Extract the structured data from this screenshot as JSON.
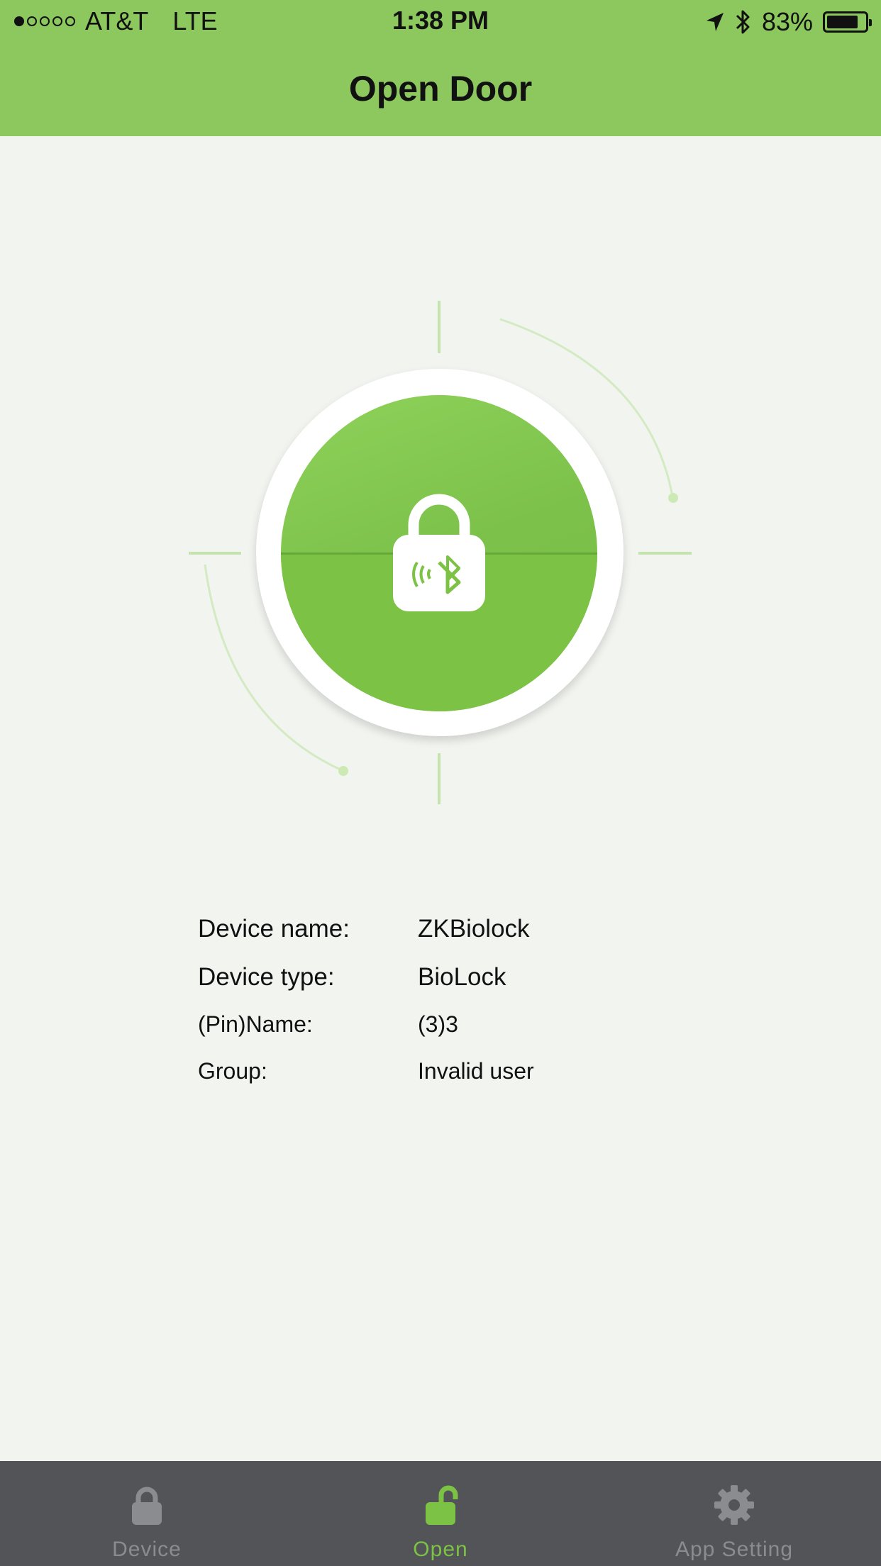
{
  "status_bar": {
    "carrier": "AT&T",
    "network": "LTE",
    "time": "1:38 PM",
    "battery_percent": "83%",
    "battery_level": 0.83,
    "signal_bars_filled": 1,
    "signal_bars_total": 5
  },
  "header": {
    "title": "Open Door"
  },
  "colors": {
    "accent": "#8cc85e",
    "button_green": "#7cc244",
    "tab_bar_bg": "#525458",
    "tab_inactive": "#8b8c8f",
    "tab_active": "#7cc244",
    "page_bg": "#f2f4f0"
  },
  "lock_button": {
    "icon": "bluetooth-lock-icon"
  },
  "device_info": {
    "rows": [
      {
        "label": "Device name:",
        "value": "ZKBiolock"
      },
      {
        "label": "Device type:",
        "value": "BioLock"
      },
      {
        "label": "(Pin)Name:",
        "value": "(3)3"
      },
      {
        "label": "Group:",
        "value": "Invalid user"
      }
    ]
  },
  "tab_bar": {
    "tabs": [
      {
        "label": "Device",
        "icon": "lock-icon",
        "active": false
      },
      {
        "label": "Open",
        "icon": "unlock-icon",
        "active": true
      },
      {
        "label": "App Setting",
        "icon": "gear-icon",
        "active": false
      }
    ]
  }
}
